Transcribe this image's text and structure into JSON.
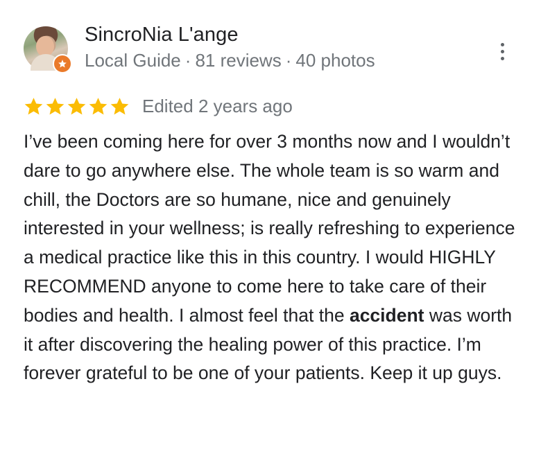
{
  "reviewer": {
    "name": "SincroNia L'ange",
    "level": "Local Guide",
    "reviews": "81 reviews",
    "photos": "40 photos",
    "separator": "·",
    "badge_icon": "star-badge-icon"
  },
  "rating": {
    "stars": 5,
    "max_stars": 5,
    "edited": "Edited 2 years ago",
    "star_color": "#fbbc04"
  },
  "review": {
    "text_before": "I’ve been coming here for over 3 months now and I wouldn’t dare to go anywhere else. The whole team is so warm and chill, the Doctors are so humane, nice and genuinely interested in your wellness; is really refreshing to experience a medical practice like this in this country. I would HIGHLY RECOMMEND anyone to come here to take care of their bodies and health. I almost feel that the ",
    "highlight": "accident",
    "text_after": " was worth it after discovering the healing power of this practice. I’m forever grateful to be one of your patients. Keep it up guys."
  },
  "icons": {
    "more": "more-vert-icon",
    "star": "star-icon"
  },
  "colors": {
    "text_primary": "#202124",
    "text_secondary": "#70757a",
    "badge": "#ea7a2a"
  }
}
